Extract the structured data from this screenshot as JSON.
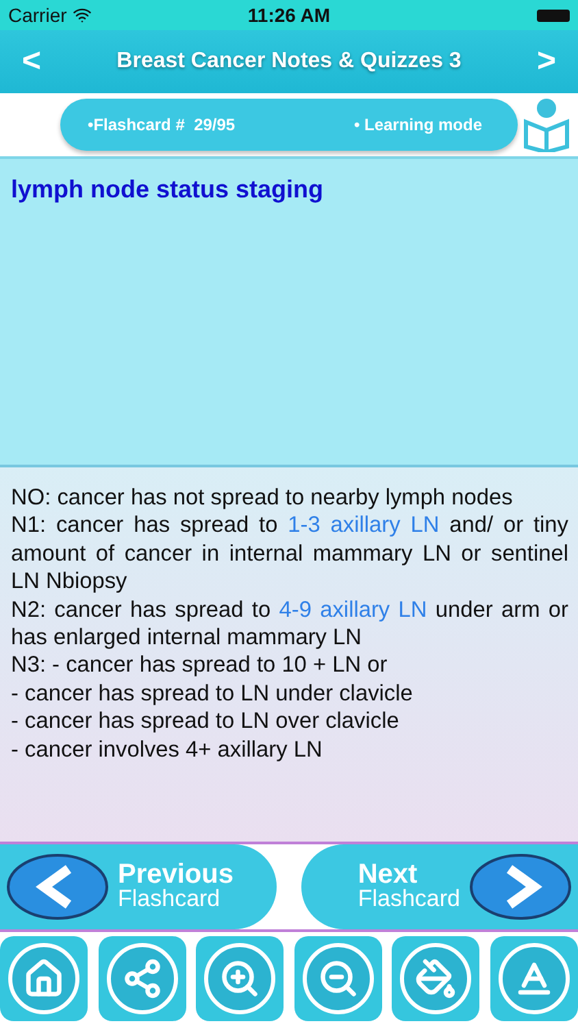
{
  "status_bar": {
    "carrier": "Carrier",
    "time": "11:26 AM"
  },
  "nav_bar": {
    "back": "<",
    "title": "Breast Cancer Notes & Quizzes 3",
    "forward": ">"
  },
  "info_bar": {
    "counter": "•Flashcard #  29/95",
    "mode": "• Learning mode"
  },
  "question": "lymph node status staging",
  "answer": [
    [
      {
        "text": "NO: cancer has not spread to nearby lymph nodes",
        "highlight": false
      }
    ],
    [
      {
        "text": "N1: cancer has spread to ",
        "highlight": false
      },
      {
        "text": "1-3 axillary LN",
        "highlight": true
      },
      {
        "text": " and/ or tiny amount of cancer in internal mammary LN or sentinel LN Nbiopsy",
        "highlight": false
      }
    ],
    [
      {
        "text": "N2: cancer has spread to ",
        "highlight": false
      },
      {
        "text": "4-9 axillary LN",
        "highlight": true
      },
      {
        "text": " under arm or has enlarged internal mammary LN",
        "highlight": false
      }
    ],
    [
      {
        "text": "N3: - cancer has spread to 10 + LN or",
        "highlight": false
      }
    ],
    [
      {
        "text": "- cancer has spread to LN under clavicle",
        "highlight": false
      }
    ],
    [
      {
        "text": "- cancer has spread to LN over clavicle",
        "highlight": false
      }
    ],
    [
      {
        "text": "- cancer involves 4+ axillary LN",
        "highlight": false
      }
    ]
  ],
  "card_nav": {
    "previous": {
      "title": "Previous",
      "subtitle": "Flashcard"
    },
    "next": {
      "title": "Next",
      "subtitle": "Flashcard"
    }
  },
  "toolbar": [
    {
      "kind": "home"
    },
    {
      "kind": "share"
    },
    {
      "kind": "zoom-in"
    },
    {
      "kind": "zoom-out"
    },
    {
      "kind": "paint"
    },
    {
      "kind": "font"
    }
  ]
}
